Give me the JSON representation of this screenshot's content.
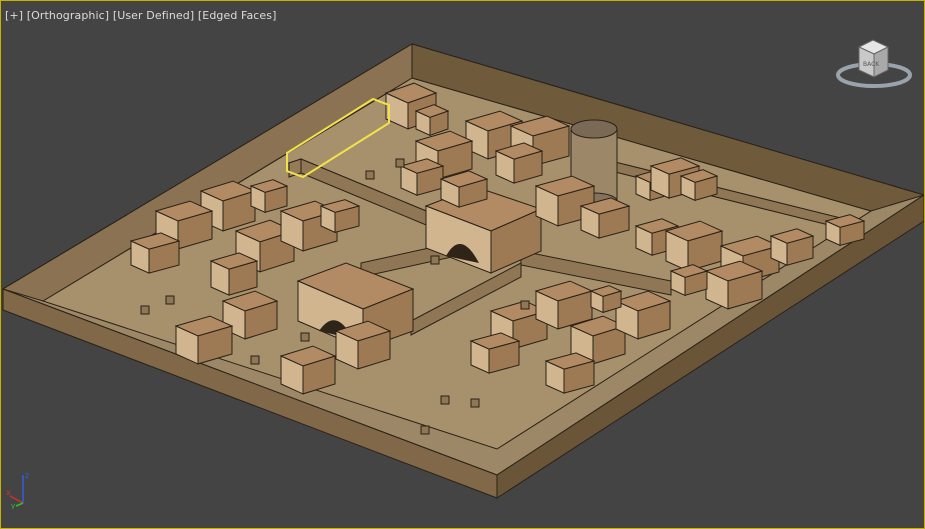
{
  "viewport": {
    "labels": {
      "plus": "[+]",
      "view": "[Orthographic]",
      "camera": "[User Defined]",
      "shading": "[Edged Faces]"
    },
    "view_cube": {
      "face_label": "BACK"
    },
    "axis_gizmo": {
      "x_label": "x",
      "y_label": "y",
      "z_label": "z"
    },
    "colors": {
      "background": "#444444",
      "border_active": "#c8b100",
      "label_text": "#dcdcdc",
      "wall_top": "#9c8866",
      "wall_side": "#77603f",
      "ground": "#a7906c",
      "house_top": "#b28a63",
      "house_left": "#d0b58f",
      "house_right": "#9d7a54",
      "selection": "#f2e24a",
      "axis_x": "#d03030",
      "axis_y": "#30c030",
      "axis_z": "#3060e0"
    }
  }
}
